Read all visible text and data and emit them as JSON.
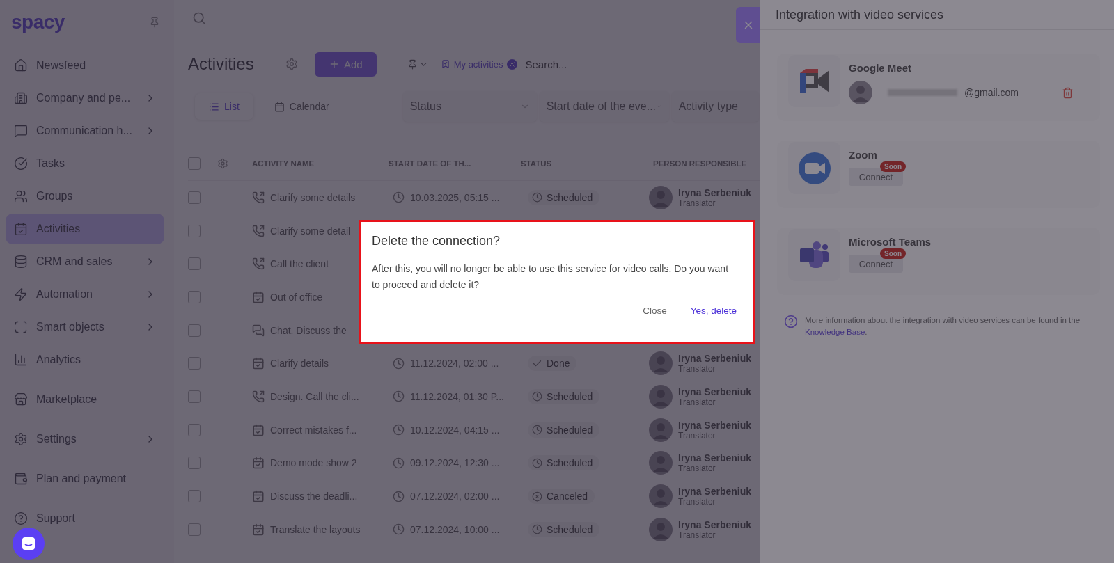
{
  "logo": {
    "text": "spacy"
  },
  "sidebar": {
    "sections": [
      [
        {
          "label": "Newsfeed",
          "selected": false,
          "has_submenu": false
        },
        {
          "label": "Company and pe...",
          "selected": false,
          "has_submenu": true
        },
        {
          "label": "Communication h...",
          "selected": false,
          "has_submenu": true
        },
        {
          "label": "Tasks",
          "selected": false,
          "has_submenu": false
        },
        {
          "label": "Groups",
          "selected": false,
          "has_submenu": false
        },
        {
          "label": "Activities",
          "selected": true,
          "has_submenu": false
        },
        {
          "label": "CRM and sales",
          "selected": false,
          "has_submenu": true
        },
        {
          "label": "Automation",
          "selected": false,
          "has_submenu": true
        },
        {
          "label": "Smart objects",
          "selected": false,
          "has_submenu": true
        },
        {
          "label": "Analytics",
          "selected": false,
          "has_submenu": false
        }
      ],
      [
        {
          "label": "Marketplace",
          "selected": false,
          "has_submenu": false
        }
      ],
      [
        {
          "label": "Settings",
          "selected": false,
          "has_submenu": true
        }
      ],
      [
        {
          "label": "Plan and payment",
          "selected": false,
          "has_submenu": false
        }
      ],
      [
        {
          "label": "Support",
          "selected": false,
          "has_submenu": false
        }
      ]
    ]
  },
  "header": {
    "title": "Activities",
    "add_button": "Add",
    "filter_chip": "My activities",
    "search": {
      "placeholder": "Search..."
    }
  },
  "view_tabs": [
    {
      "label": "List",
      "selected": true
    },
    {
      "label": "Calendar",
      "selected": false
    }
  ],
  "filters": [
    "Status",
    "Start date of the eve...",
    "Activity type"
  ],
  "table": {
    "header_checked": false,
    "columns": [
      "ACTIVITY NAME",
      "START DATE OF TH...",
      "STATUS",
      "PERSON RESPONSIBLE"
    ],
    "rows": [
      {
        "kind": "call",
        "checked": false,
        "name": "Clarify some details",
        "date": "10.03.2025, 05:15 ...",
        "status": {
          "kind": "scheduled",
          "label": "Scheduled"
        },
        "person": "Iryna Serbeniuk",
        "role": "Translator"
      },
      {
        "kind": "call",
        "checked": false,
        "name": "Clarify some detail"
      },
      {
        "kind": "call",
        "checked": false,
        "name": "Call the client"
      },
      {
        "kind": "event",
        "checked": false,
        "name": "Out of office"
      },
      {
        "kind": "chat",
        "checked": false,
        "name": "Chat. Discuss the"
      },
      {
        "kind": "event",
        "checked": false,
        "name": "Clarify details",
        "date": "11.12.2024, 02:00 ...",
        "status": {
          "kind": "done",
          "label": "Done"
        },
        "person": "Iryna Serbeniuk",
        "role": "Translator"
      },
      {
        "kind": "call",
        "checked": false,
        "name": "Design. Call the cli...",
        "date": "11.12.2024, 01:30 P...",
        "status": {
          "kind": "scheduled",
          "label": "Scheduled"
        },
        "person": "Iryna Serbeniuk",
        "role": "Translator"
      },
      {
        "kind": "event",
        "checked": false,
        "name": "Correct mistakes f...",
        "date": "10.12.2024, 04:15 ...",
        "status": {
          "kind": "scheduled",
          "label": "Scheduled"
        },
        "person": "Iryna Serbeniuk",
        "role": "Translator"
      },
      {
        "kind": "event",
        "checked": false,
        "name": "Demo mode show 2",
        "date": "09.12.2024, 12:30 ...",
        "status": {
          "kind": "scheduled",
          "label": "Scheduled"
        },
        "person": "Iryna Serbeniuk",
        "role": "Translator"
      },
      {
        "kind": "event",
        "checked": false,
        "name": "Discuss the deadli...",
        "date": "07.12.2024, 02:00 ...",
        "status": {
          "kind": "canceled",
          "label": "Canceled"
        },
        "person": "Iryna Serbeniuk",
        "role": "Translator"
      },
      {
        "kind": "event",
        "checked": false,
        "name": "Translate the layouts",
        "date": "07.12.2024, 10:00 ...",
        "status": {
          "kind": "scheduled",
          "label": "Scheduled"
        },
        "person": "Iryna Serbeniuk",
        "role": "Translator"
      }
    ]
  },
  "drawer": {
    "title": "Integration with video services",
    "services": [
      {
        "kind": "account",
        "name": "Google Meet",
        "account": "@gmail.com"
      },
      {
        "kind": "connect",
        "name": "Zoom",
        "button": "Connect",
        "badge": "Soon"
      },
      {
        "kind": "connect",
        "name": "Microsoft Teams",
        "button": "Connect",
        "badge": "Soon"
      }
    ],
    "info": "More information about the integration with video services can be found in the",
    "info_link": "Knowledge Base",
    "info_end": "."
  },
  "dialog": {
    "title": "Delete the connection?",
    "message": "After this, you will no longer be able to use this service for video calls. Do you want to proceed and delete it?",
    "buttons": [
      {
        "kind": "secondary",
        "label": "Close"
      },
      {
        "kind": "primary",
        "label": "Yes, delete"
      }
    ]
  }
}
